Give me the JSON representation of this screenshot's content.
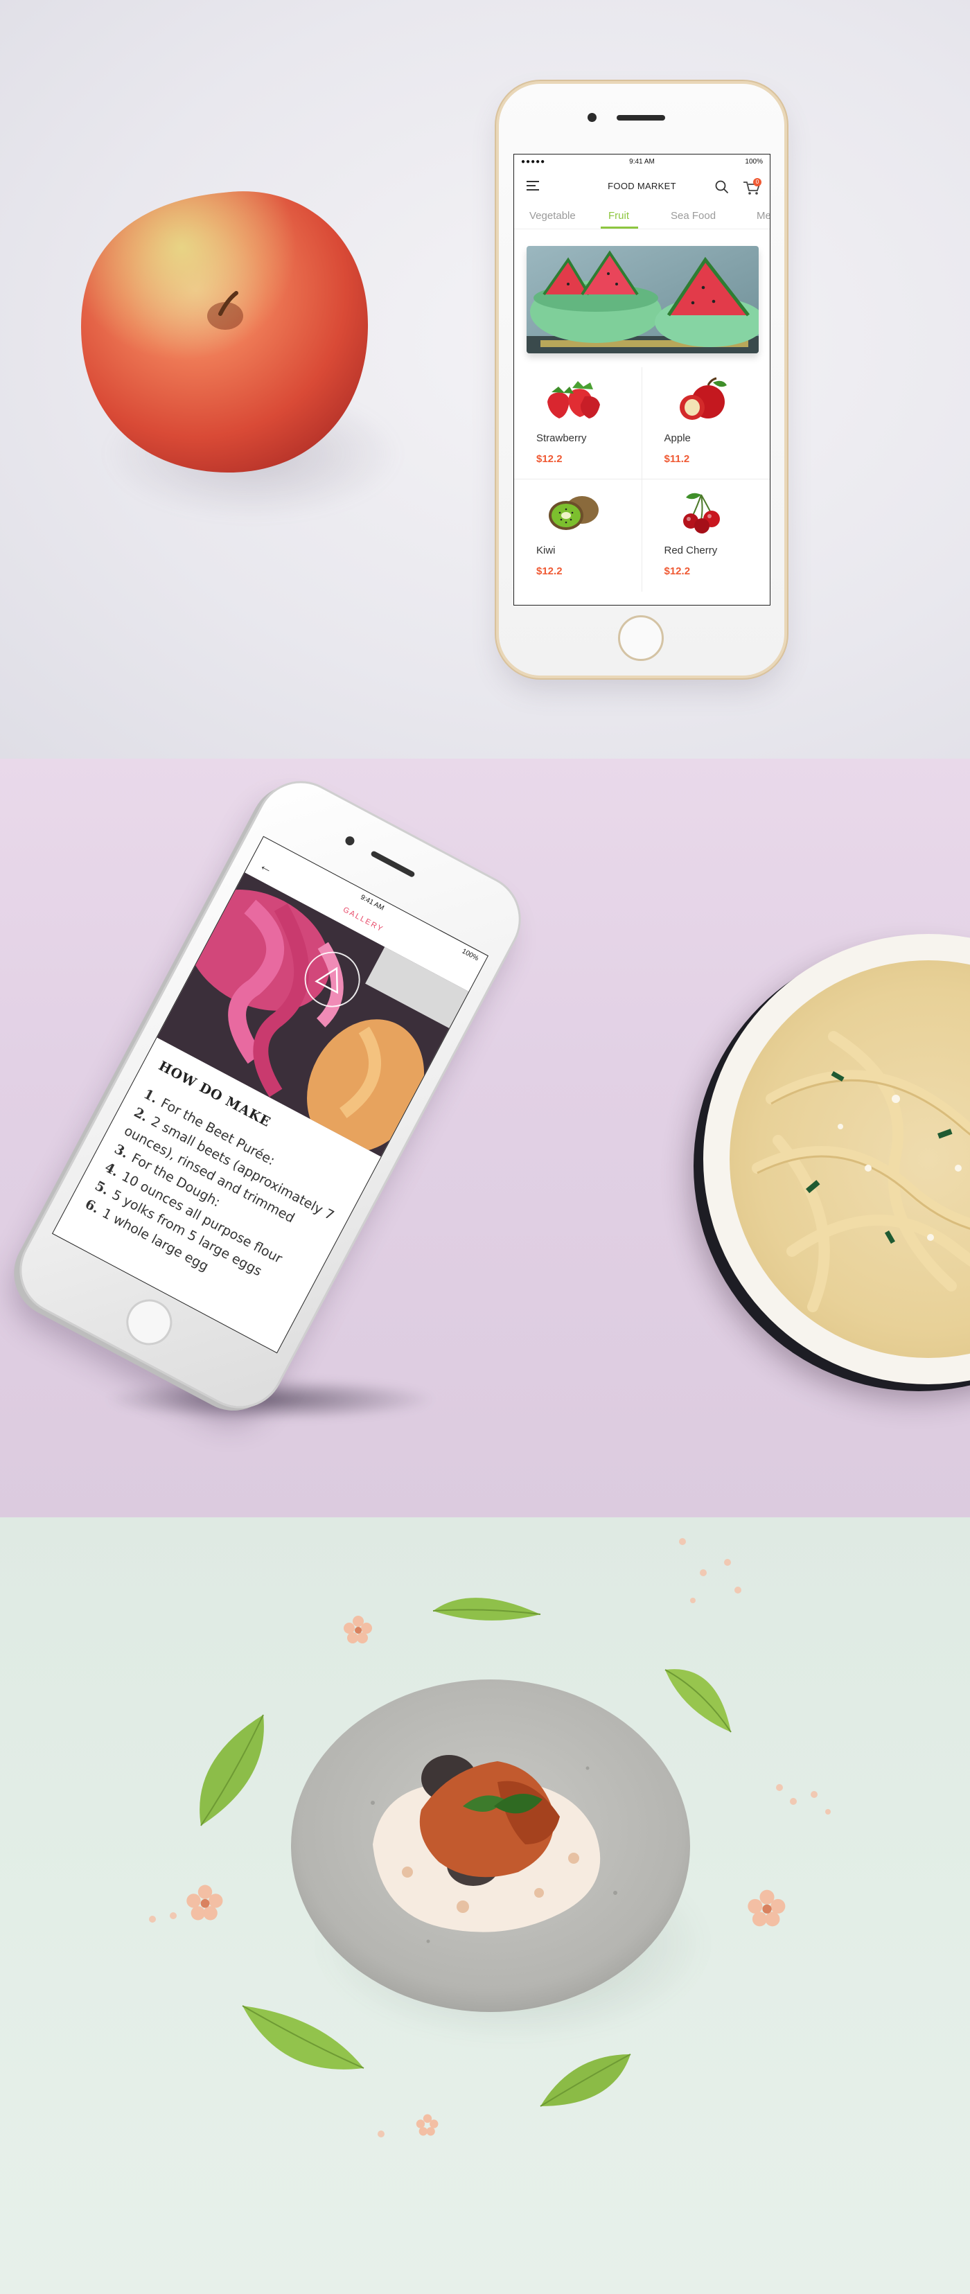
{
  "food_market": {
    "status": {
      "carrier": "●●●●● ",
      "time": "9:41 AM",
      "battery": "100%"
    },
    "title": "FOOD MARKET",
    "cart_count": "0",
    "tabs": [
      {
        "label": "Vegetable",
        "active": false
      },
      {
        "label": "Fruit",
        "active": true
      },
      {
        "label": "Sea Food",
        "active": false
      },
      {
        "label": "Me",
        "active": false
      }
    ],
    "products": [
      {
        "name": "Strawberry",
        "price": "$12.2"
      },
      {
        "name": "Apple",
        "price": "$11.2"
      },
      {
        "name": "Kiwi",
        "price": "$12.2"
      },
      {
        "name": "Red Cherry",
        "price": "$12.2"
      }
    ]
  },
  "gallery": {
    "time": "9:41 AM",
    "battery": "100%",
    "title": "GALLERY",
    "back_icon": "back-arrow-icon",
    "heading": "HOW DO MAKE",
    "steps": [
      {
        "num": "1.",
        "text": "For the Beet Purée:"
      },
      {
        "num": "2.",
        "text": "2 small beets (approximately 7 ounces), rinsed and trimmed"
      },
      {
        "num": "3.",
        "text": "For the Dough:"
      },
      {
        "num": "4.",
        "text": "10 ounces all purpose flour"
      },
      {
        "num": "5.",
        "text": "5 yolks from 5 large eggs"
      },
      {
        "num": "6.",
        "text": "1 whole large egg"
      }
    ]
  },
  "colors": {
    "accent_green": "#8dc63f",
    "price_orange": "#ef5a34",
    "gallery_pink": "#e84b6a"
  }
}
